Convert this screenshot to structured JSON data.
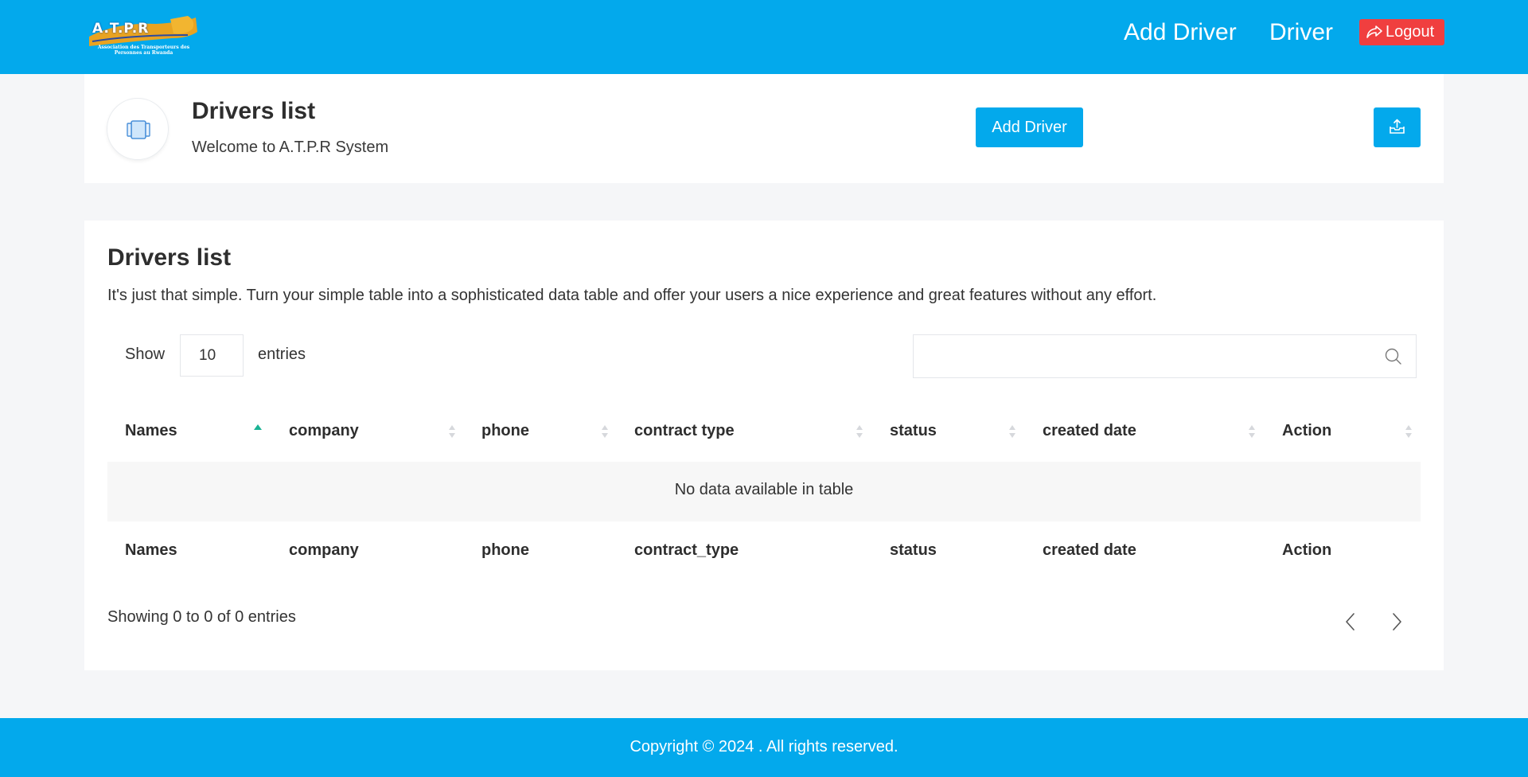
{
  "header": {
    "logo_text": "A.T.P.R",
    "logo_subtitle": "Association des Transporteurs des Personnes au Rwanda",
    "nav": {
      "add_driver": "Add Driver",
      "driver": "Driver",
      "logout": "Logout"
    },
    "colors": {
      "bar": "#03a9ec",
      "logout": "#f03f3f"
    }
  },
  "welcome_card": {
    "icon": "tablet-icon",
    "title": "Drivers list",
    "subtitle": "Welcome to A.T.P.R System",
    "add_button": "Add Driver",
    "export_icon": "export-tray-icon"
  },
  "table_card": {
    "title": "Drivers list",
    "description": "It's just that simple. Turn your simple table into a sophisticated data table and offer your users a nice experience and great features without any effort.",
    "show_label": "Show",
    "entries_value": "10",
    "entries_label": "entries",
    "search_value": "",
    "search_icon": "search-icon",
    "columns": [
      "Names",
      "company",
      "phone",
      "contract type",
      "status",
      "created date",
      "Action"
    ],
    "footer_columns": [
      "Names",
      "company",
      "phone",
      "contract_type",
      "status",
      "created date",
      "Action"
    ],
    "sorted_column": "Names",
    "sort_direction": "asc",
    "empty_message": "No data available in table",
    "info": "Showing 0 to 0 of 0 entries",
    "pagination": {
      "prev_icon": "chevron-left-icon",
      "next_icon": "chevron-right-icon"
    }
  },
  "footer": {
    "copyright": "Copyright © 2024 . All rights reserved."
  }
}
